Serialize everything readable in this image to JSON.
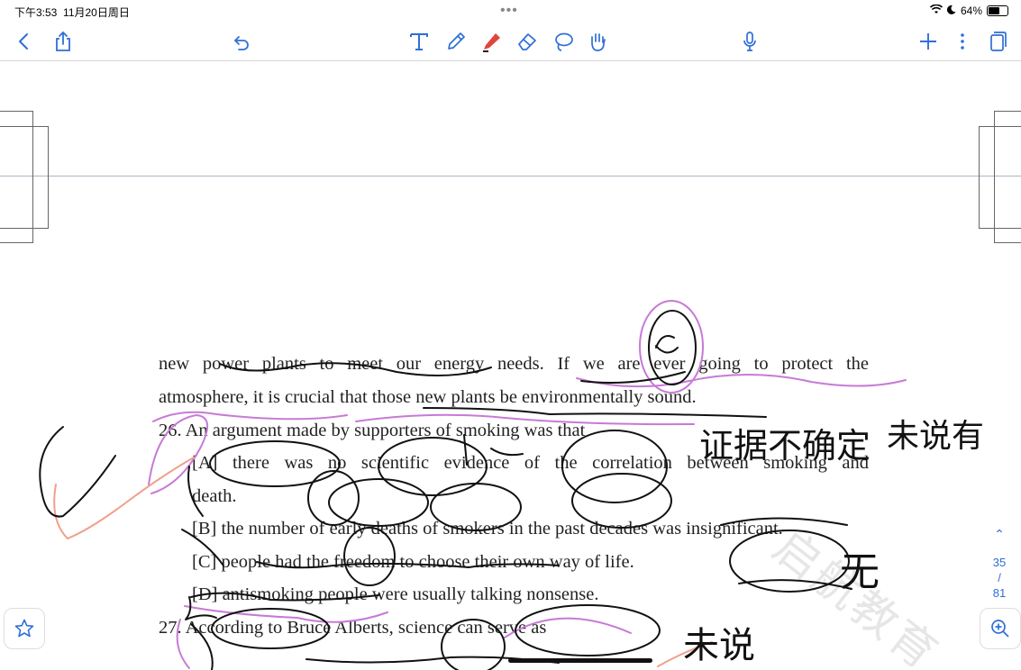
{
  "status": {
    "time": "下午3:53",
    "date": "11月20日周日",
    "battery": "64%",
    "battery_level": 0.64
  },
  "toolbar": {
    "icons": [
      "back-icon",
      "share-icon",
      "undo-icon",
      "text-tool-icon",
      "pen-icon",
      "highlighter-icon",
      "eraser-icon",
      "lasso-icon",
      "hand-icon",
      "mic-icon",
      "plus-icon",
      "more-icon",
      "pages-icon"
    ],
    "accent": "#2f6fd6",
    "highlighter_color": "#e0463c"
  },
  "document": {
    "lines": [
      "new power plants to meet our energy needs. If we are ever going to protect the",
      "atmosphere, it is crucial that those new plants be environmentally sound.",
      "26. An argument made by supporters of smoking was that",
      "[A] there was no scientific evidence of the correlation between smoking and",
      "death.",
      "[B] the number of early deaths of smokers in the past decades was insignificant.",
      "[C] people had the freedom to choose their own way of life.",
      "[D] antismoking people were usually talking nonsense.",
      "27. According to Bruce Alberts, science can serve as"
    ],
    "ink_color": "#111111",
    "pen_color_purple": "#c77ad6",
    "pen_color_salmon": "#f0a08a"
  },
  "handwriting": {
    "note_1": "证据不确定",
    "note_2": "未说有",
    "note_3": "无",
    "note_4": "未说"
  },
  "watermark": "启航教育",
  "pager": {
    "current": "35",
    "separator": "/",
    "total": "81"
  }
}
